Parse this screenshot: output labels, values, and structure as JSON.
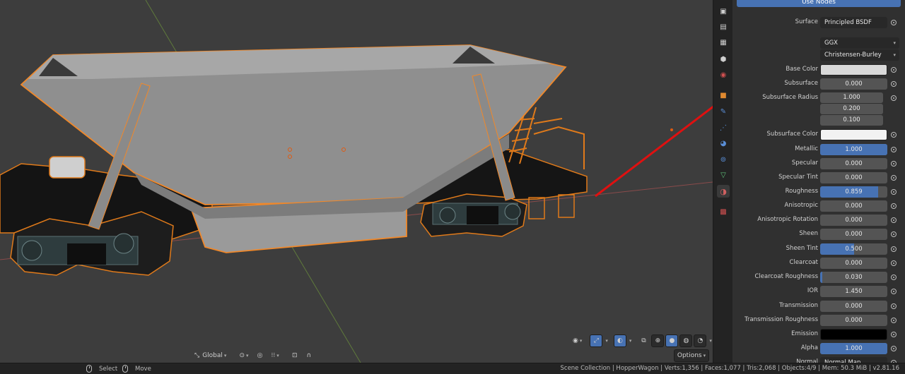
{
  "viewport": {
    "header_left": {
      "transform_orientation": "Global",
      "options_label": "Options"
    },
    "icons": [
      "pivot-icon",
      "transform-orientation-icon",
      "snap-icon",
      "snap-target-icon",
      "proportional-edit-icon",
      "falloff-icon",
      "visibility-icon",
      "gizmo-icon",
      "overlay-icon",
      "xray-icon",
      "wireframe-shading-icon",
      "solid-shading-icon",
      "material-shading-icon",
      "rendered-shading-icon"
    ]
  },
  "tabstrip": {
    "tabs": [
      "render-tab",
      "output-tab",
      "view-layer-tab",
      "scene-tab",
      "world-tab",
      "object-tab",
      "modifier-tab",
      "particles-tab",
      "physics-tab",
      "constraints-tab",
      "data-tab",
      "material-tab",
      "texture-tab"
    ],
    "active": "material-tab"
  },
  "material": {
    "use_nodes_label": "Use Nodes",
    "surface_label": "Surface",
    "surface_value": "Principled BSDF",
    "distribution": "GGX",
    "subsurface_method": "Christensen-Burley",
    "params": [
      {
        "label": "Base Color",
        "kind": "color",
        "color": "#d9d9d9"
      },
      {
        "label": "Subsurface",
        "kind": "value",
        "value": "0.000",
        "fill": 0
      },
      {
        "label": "Subsurface Radius",
        "kind": "vector",
        "values": [
          "1.000",
          "0.200",
          "0.100"
        ]
      },
      {
        "label": "Subsurface Color",
        "kind": "color",
        "color": "#f2f2f2"
      },
      {
        "label": "Metallic",
        "kind": "value",
        "value": "1.000",
        "fill": 1.0
      },
      {
        "label": "Specular",
        "kind": "value",
        "value": "0.000",
        "fill": 0
      },
      {
        "label": "Specular Tint",
        "kind": "value",
        "value": "0.000",
        "fill": 0
      },
      {
        "label": "Roughness",
        "kind": "value",
        "value": "0.859",
        "fill": 0.859
      },
      {
        "label": "Anisotropic",
        "kind": "value",
        "value": "0.000",
        "fill": 0
      },
      {
        "label": "Anisotropic Rotation",
        "kind": "value",
        "value": "0.000",
        "fill": 0
      },
      {
        "label": "Sheen",
        "kind": "value",
        "value": "0.000",
        "fill": 0
      },
      {
        "label": "Sheen Tint",
        "kind": "value",
        "value": "0.500",
        "fill": 0.5
      },
      {
        "label": "Clearcoat",
        "kind": "value",
        "value": "0.000",
        "fill": 0
      },
      {
        "label": "Clearcoat Roughness",
        "kind": "value",
        "value": "0.030",
        "fill": 0.03
      },
      {
        "label": "IOR",
        "kind": "value",
        "value": "1.450",
        "fill": 0
      },
      {
        "label": "Transmission",
        "kind": "value",
        "value": "0.000",
        "fill": 0
      },
      {
        "label": "Transmission Roughness",
        "kind": "value",
        "value": "0.000",
        "fill": 0
      },
      {
        "label": "Emission",
        "kind": "color",
        "color": "#000000"
      },
      {
        "label": "Alpha",
        "kind": "value",
        "value": "1.000",
        "fill": 1.0
      },
      {
        "label": "Normal",
        "kind": "link",
        "value": "Normal Map"
      }
    ]
  },
  "statusbar": {
    "select_label": "Select",
    "move_label": "Move",
    "info": "Scene Collection | HopperWagon | Verts:1,356 | Faces:1,077 | Tris:2,068 | Objects:4/9 | Mem: 50.3 MiB | v2.81.16"
  },
  "colors": {
    "accent": "#4772b3",
    "selection_outline": "#f08a24",
    "annotation_arrow": "#e01010"
  }
}
